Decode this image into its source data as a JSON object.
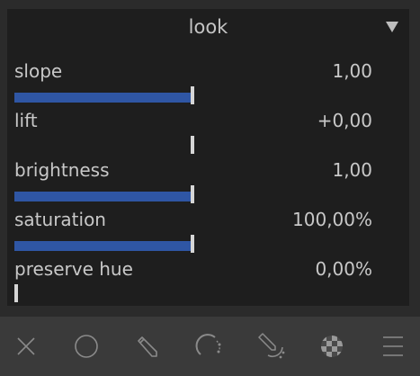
{
  "module": {
    "title": "look",
    "collapse_icon": "triangle-down-icon"
  },
  "sliders": [
    {
      "label": "slope",
      "value": "1,00",
      "level": 1.0
    },
    {
      "label": "lift",
      "value": "+0,00",
      "level": 0.0
    },
    {
      "label": "brightness",
      "value": "1,00",
      "level": 1.0
    },
    {
      "label": "saturation",
      "value": "100,00%",
      "level": 1.0
    },
    {
      "label": "preserve hue",
      "value": "0,00%",
      "level": 0.0
    }
  ],
  "toolbar": {
    "icons": [
      "close-icon",
      "circle-icon",
      "pencil-icon",
      "arc-icon",
      "pencil-arc-icon",
      "checkerboard-icon",
      "menu-icon"
    ]
  },
  "colors": {
    "accent": "#2f56a4",
    "panel_bg": "#1e1e1e",
    "toolbar_bg": "#3a3a3a"
  }
}
